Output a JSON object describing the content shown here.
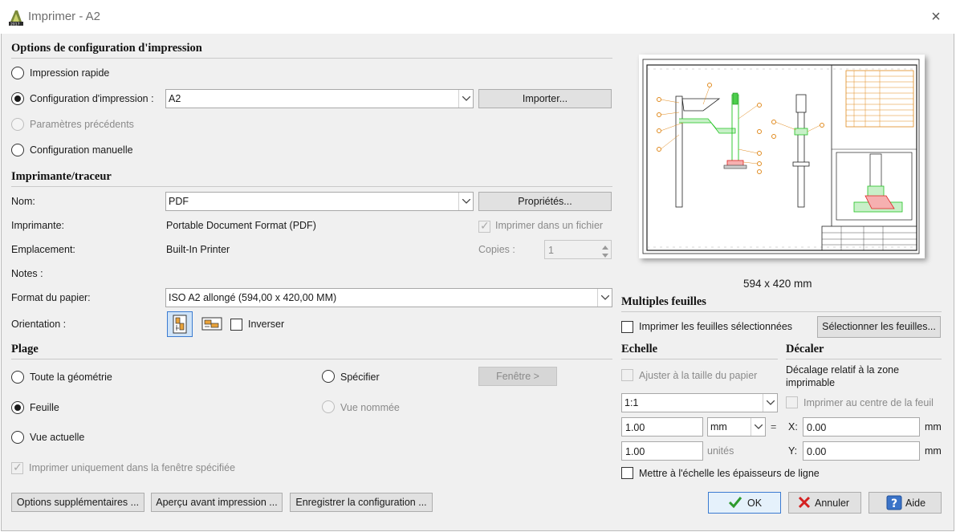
{
  "window": {
    "title": "Imprimer - A2",
    "close_glyph": "×"
  },
  "print_options": {
    "heading": "Options de configuration d'impression",
    "quick_label": "Impression rapide",
    "config_label": "Configuration d'impression :",
    "config_value": "A2",
    "import_label": "Importer...",
    "previous_label": "Paramètres précédents",
    "manual_label": "Configuration manuelle"
  },
  "printer": {
    "heading": "Imprimante/traceur",
    "name_label": "Nom:",
    "name_value": "PDF",
    "properties_label": "Propriétés...",
    "printer_label": "Imprimante:",
    "printer_value": "Portable Document Format (PDF)",
    "print_to_file_label": "Imprimer dans un fichier",
    "location_label": "Emplacement:",
    "location_value": "Built-In Printer",
    "copies_label": "Copies :",
    "copies_value": "1",
    "notes_label": "Notes :",
    "paper_label": "Format du papier:",
    "paper_value": "ISO A2 allongé (594,00 x 420,00 MM)",
    "orientation_label": "Orientation :",
    "invert_label": "Inverser"
  },
  "range": {
    "heading": "Plage",
    "all_geometry_label": "Toute la géométrie",
    "specify_label": "Spécifier",
    "window_button_label": "Fenêtre >",
    "sheet_label": "Feuille",
    "named_view_label": "Vue nommée",
    "current_view_label": "Vue actuelle",
    "only_window_label": "Imprimer uniquement dans la fenêtre spécifiée"
  },
  "bottom_buttons": {
    "more_options": "Options supplémentaires ...",
    "preview": "Aperçu avant impression ...",
    "save_config": "Enregistrer la configuration ..."
  },
  "preview": {
    "size_text": "594 x 420 mm"
  },
  "multi_sheets": {
    "heading": "Multiples feuilles",
    "print_selected_label": "Imprimer les feuilles sélectionnées",
    "select_sheets_label": "Sélectionner les feuilles..."
  },
  "scale": {
    "heading": "Echelle",
    "fit_label": "Ajuster à la taille du papier",
    "ratio_value": "1:1",
    "value1": "1.00",
    "unit1": "mm",
    "equals": "=",
    "value2": "1.00",
    "unit2": "unités",
    "lineweight_label": "Mettre à l'échelle les épaisseurs de ligne"
  },
  "offset": {
    "heading": "Décaler",
    "relative_label": "Décalage relatif à la zone imprimable",
    "center_label": "Imprimer au centre de la feuil",
    "x_label": "X:",
    "x_value": "0.00",
    "x_unit": "mm",
    "y_label": "Y:",
    "y_value": "0.00",
    "y_unit": "mm"
  },
  "actions": {
    "ok": "OK",
    "cancel": "Annuler",
    "help": "Aide"
  },
  "colors": {
    "accent": "#3b7bd1",
    "drawing_green": "#22c322",
    "drawing_orange": "#e08a1e",
    "drawing_red": "#e02020"
  }
}
